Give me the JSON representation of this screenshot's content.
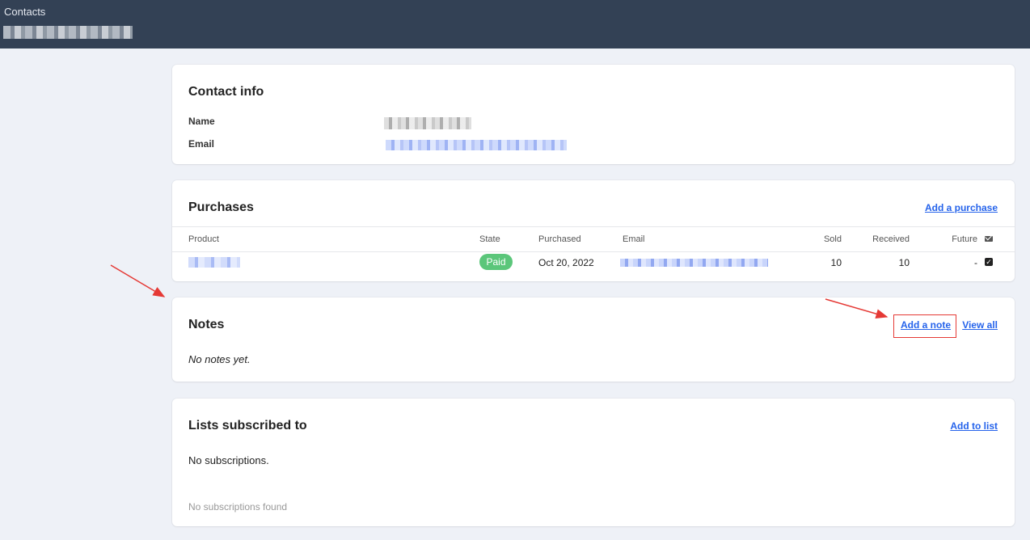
{
  "header": {
    "breadcrumb": "Contacts"
  },
  "contact_info": {
    "title": "Contact info",
    "name_label": "Name",
    "email_label": "Email"
  },
  "purchases": {
    "title": "Purchases",
    "add_link": "Add a purchase",
    "columns": [
      "Product",
      "State",
      "Purchased",
      "Email",
      "Sold",
      "Received",
      "Future"
    ],
    "rows": [
      {
        "state": "Paid",
        "purchased": "Oct 20, 2022",
        "sold": "10",
        "received": "10",
        "future": "-"
      }
    ],
    "icons": {
      "header_icon": "envelope-icon",
      "row_checkbox": "checked-checkbox-icon"
    },
    "colors": {
      "paid_badge": "#5bc67a",
      "link": "#2563eb"
    }
  },
  "notes": {
    "title": "Notes",
    "add_link": "Add a note",
    "view_link": "View all",
    "empty_text": "No notes yet."
  },
  "lists": {
    "title": "Lists subscribed to",
    "add_link": "Add to list",
    "empty_text": "No subscriptions.",
    "found_text": "No subscriptions found"
  },
  "annotations": {
    "color": "#e53935"
  }
}
